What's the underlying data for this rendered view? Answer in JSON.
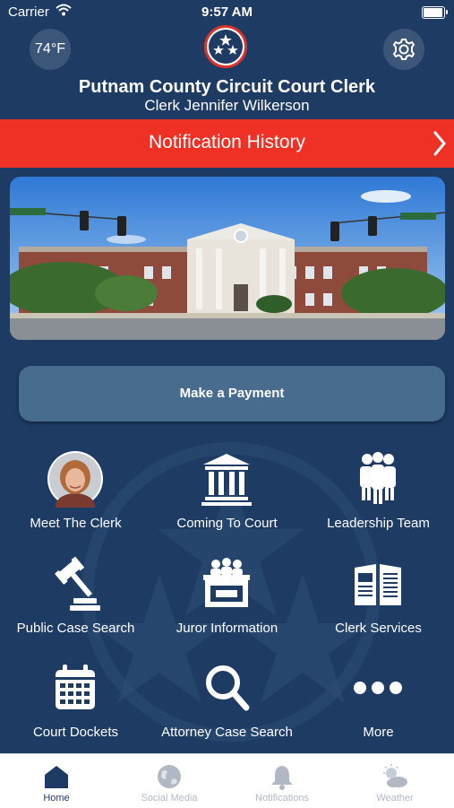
{
  "status_bar": {
    "carrier": "Carrier",
    "time": "9:57 AM"
  },
  "header": {
    "temperature": "74°F",
    "title": "Putnam County Circuit Court Clerk",
    "subtitle": "Clerk Jennifer Wilkerson"
  },
  "notification_banner": {
    "label": "Notification History"
  },
  "payment_button": {
    "label": "Make a Payment"
  },
  "grid": [
    {
      "label": "Meet The Clerk",
      "icon": "clerk-avatar"
    },
    {
      "label": "Coming To Court",
      "icon": "courthouse-icon"
    },
    {
      "label": "Leadership Team",
      "icon": "team-icon"
    },
    {
      "label": "Public Case Search",
      "icon": "gavel-icon"
    },
    {
      "label": "Juror Information",
      "icon": "jury-box-icon"
    },
    {
      "label": "Clerk Services",
      "icon": "open-book-icon"
    },
    {
      "label": "Court Dockets",
      "icon": "calendar-icon"
    },
    {
      "label": "Attorney Case Search",
      "icon": "magnifier-icon"
    },
    {
      "label": "More",
      "icon": "more-dots-icon"
    }
  ],
  "tabs": [
    {
      "label": "Home",
      "icon": "home-icon",
      "active": true
    },
    {
      "label": "Social Media",
      "icon": "globe-icon",
      "active": false
    },
    {
      "label": "Notifications",
      "icon": "bell-icon",
      "active": false
    },
    {
      "label": "Weather",
      "icon": "weather-icon",
      "active": false
    }
  ],
  "colors": {
    "background": "#1d3b63",
    "banner_red": "#ee3124",
    "button_blue": "#476c8e",
    "tab_inactive": "#b0b8c4"
  }
}
